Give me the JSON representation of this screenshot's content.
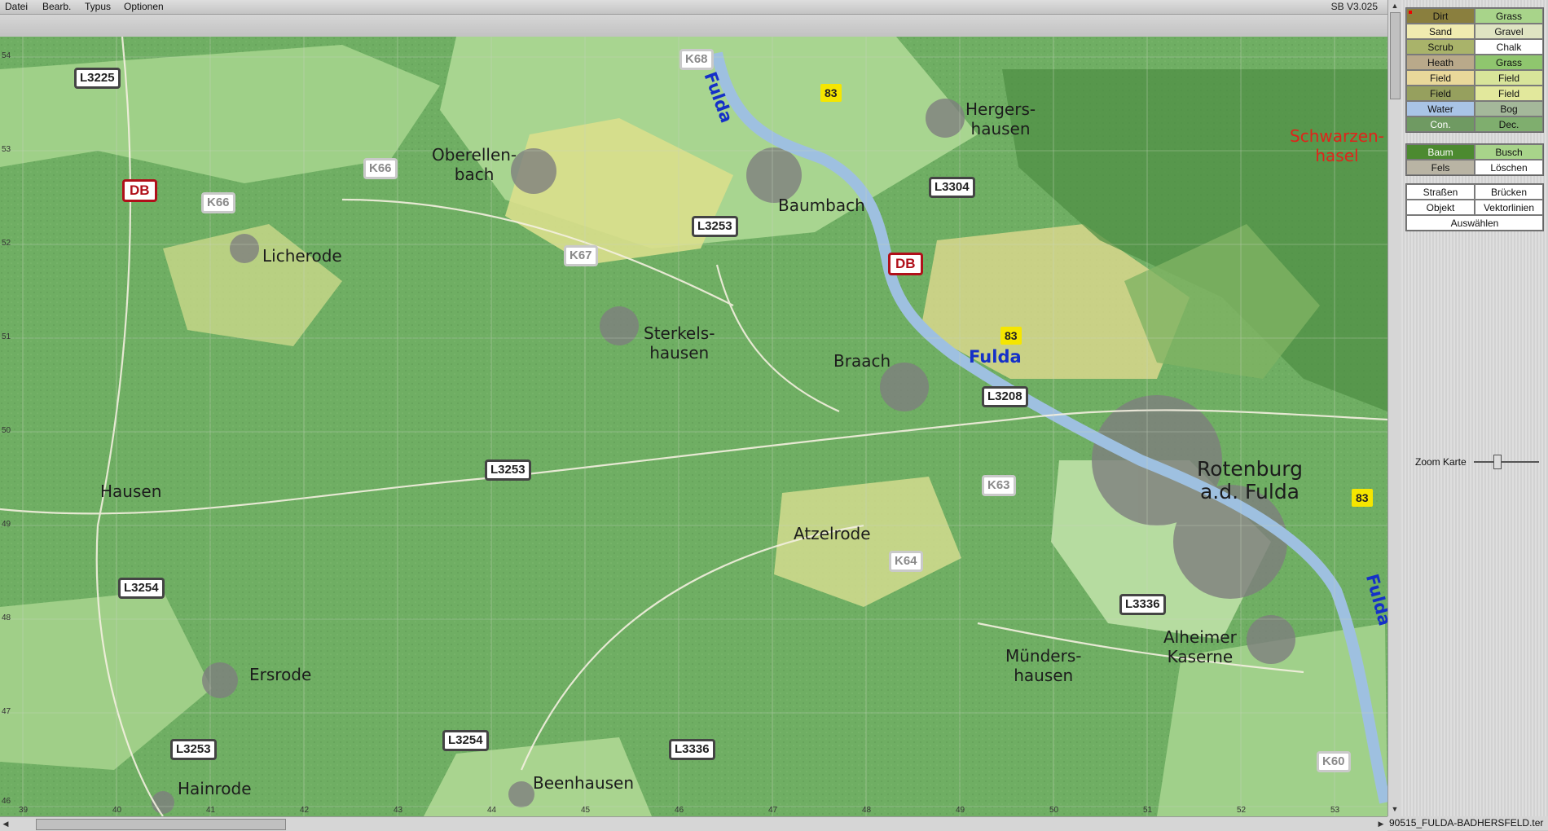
{
  "menu": {
    "items": [
      "Datei",
      "Bearb.",
      "Typus",
      "Optionen"
    ],
    "version": "SB V3.025"
  },
  "map": {
    "places": {
      "oberellenbach": "Oberellen-\nbach",
      "herghausen": "Hergers-\nhausen",
      "baumbach": "Baumbach",
      "licherode": "Licherode",
      "sterkelshausen": "Sterkels-\nhausen",
      "braach": "Braach",
      "hausen": "Hausen",
      "atzelrode": "Atzelrode",
      "rotenburg": "Rotenburg\na.d. Fulda",
      "schwarzenhasel": "Schwarzen-\nhasel",
      "alheimer": "Alheimer\nKaserne",
      "mundershausen": "Münders-\nhausen",
      "ersrode": "Ersrode",
      "hainrode": "Hainrode",
      "beenhausen": "Beenhausen"
    },
    "rivers": {
      "fulda_top": "Fulda",
      "fulda_mid": "Fulda",
      "fulda_right": "Fulda"
    },
    "roads": {
      "l3225": "L3225",
      "k68": "K68",
      "b83_top": "83",
      "k66_a": "K66",
      "db_left": "DB",
      "k66_b": "K66",
      "l3304": "L3304",
      "l3253_top": "L3253",
      "k67": "K67",
      "db_mid": "DB",
      "b83_mid": "83",
      "l3208": "L3208",
      "l3253_mid": "L3253",
      "k63": "K63",
      "b83_right": "83",
      "k64": "K64",
      "l3254_left": "L3254",
      "l3336_right": "L3336",
      "l3253_bottom": "L3253",
      "l3254_bottom": "L3254",
      "l3336_bottom": "L3336",
      "k60": "K60"
    },
    "grid_left": [
      "54",
      "53",
      "52",
      "51",
      "50",
      "49",
      "48",
      "47",
      "46"
    ],
    "grid_bottom": [
      "39",
      "40",
      "41",
      "42",
      "43",
      "44",
      "45",
      "46",
      "47",
      "48",
      "49",
      "50",
      "51",
      "52",
      "53"
    ]
  },
  "panel": {
    "terrain": [
      {
        "label": "Dirt",
        "color": "#8a7f3e",
        "selected": true
      },
      {
        "label": "Grass",
        "color": "#a8d48a"
      },
      {
        "label": "Sand",
        "color": "#f0ebb0"
      },
      {
        "label": "Gravel",
        "color": "#dfe4c2"
      },
      {
        "label": "Scrub",
        "color": "#a9b36a"
      },
      {
        "label": "Chalk",
        "color": "#ffffff"
      },
      {
        "label": "Heath",
        "color": "#b9a98a"
      },
      {
        "label": "Grass",
        "color": "#8fc66e"
      },
      {
        "label": "Field",
        "color": "#e9d89a"
      },
      {
        "label": "Field",
        "color": "#d8e49a"
      },
      {
        "label": "Field",
        "color": "#96a05e"
      },
      {
        "label": "Field",
        "color": "#e2e89c"
      },
      {
        "label": "Water",
        "color": "#a9c4e6"
      },
      {
        "label": "Bog",
        "color": "#a4b89a"
      },
      {
        "label": "Con.",
        "color": "#6f9a62"
      },
      {
        "label": "Dec.",
        "color": "#7fae6e"
      }
    ],
    "vegetation": [
      {
        "label": "Baum",
        "color": "#4c8a30"
      },
      {
        "label": "Busch",
        "color": "#a8d48a"
      },
      {
        "label": "Fels",
        "color": "#b9b4a4"
      },
      {
        "label": "Löschen",
        "color": "#ffffff"
      }
    ],
    "tools": {
      "strassen": "Straßen",
      "brucken": "Brücken",
      "objekt": "Objekt",
      "vektorlinien": "Vektorlinien",
      "auswahlen": "Auswählen"
    },
    "zoom_label": "Zoom Karte",
    "zoom_level": 0.35
  },
  "status": {
    "filename": "90515_FULDA-BADHERSFELD.ter"
  }
}
